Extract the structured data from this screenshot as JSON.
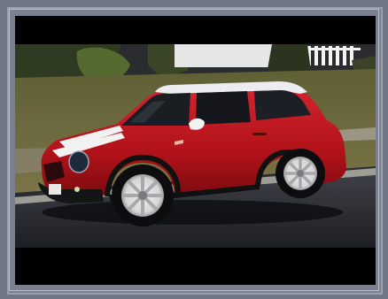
{
  "image": {
    "subject": "red-hatchback-car",
    "colors": {
      "frame": "#6f7686",
      "letterbox": "#000000",
      "car_body": "#b5141d",
      "car_roof": "#e9e9ee",
      "grass": "#6b6a3c",
      "road": "#2c2f35"
    }
  }
}
